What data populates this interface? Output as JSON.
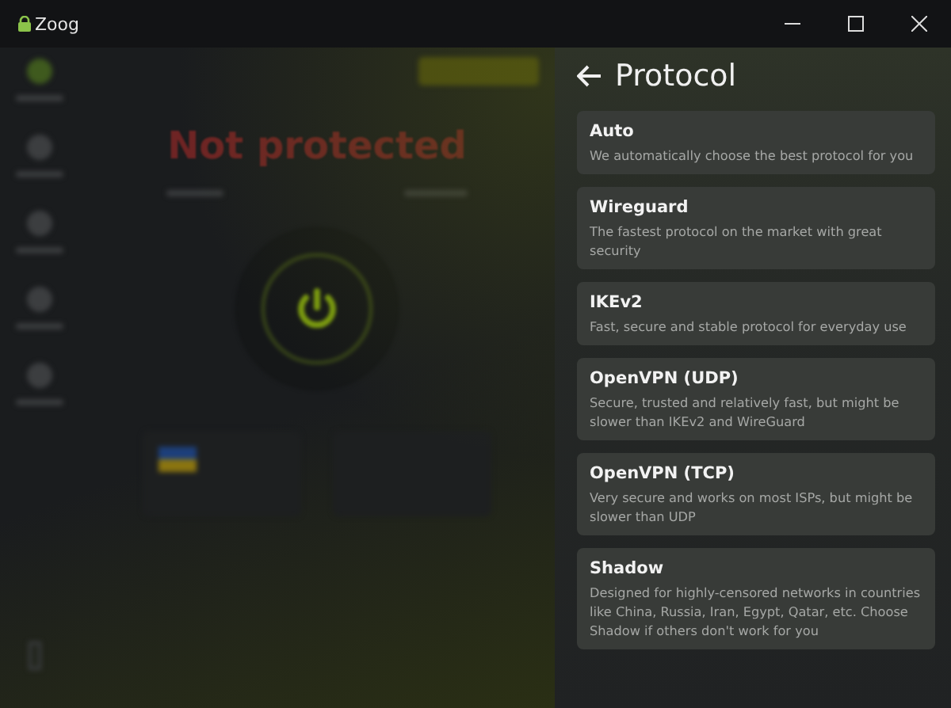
{
  "window": {
    "title": "Zoog"
  },
  "home": {
    "status": "Not protected"
  },
  "panel": {
    "title": "Protocol",
    "protocols": [
      {
        "name": "Auto",
        "description": "We automatically choose the best protocol for you"
      },
      {
        "name": "Wireguard",
        "description": "The fastest protocol on the market with great security"
      },
      {
        "name": "IKEv2",
        "description": "Fast, secure and stable protocol for everyday use"
      },
      {
        "name": "OpenVPN (UDP)",
        "description": "Secure, trusted and relatively fast, but might be slower than IKEv2 and WireGuard"
      },
      {
        "name": "OpenVPN (TCP)",
        "description": "Very secure and works on most ISPs, but might be slower than UDP"
      },
      {
        "name": "Shadow",
        "description": "Designed for highly-censored networks in countries like China, Russia, Iran, Egypt, Qatar, etc. Choose Shadow if others don't work for you"
      }
    ]
  }
}
